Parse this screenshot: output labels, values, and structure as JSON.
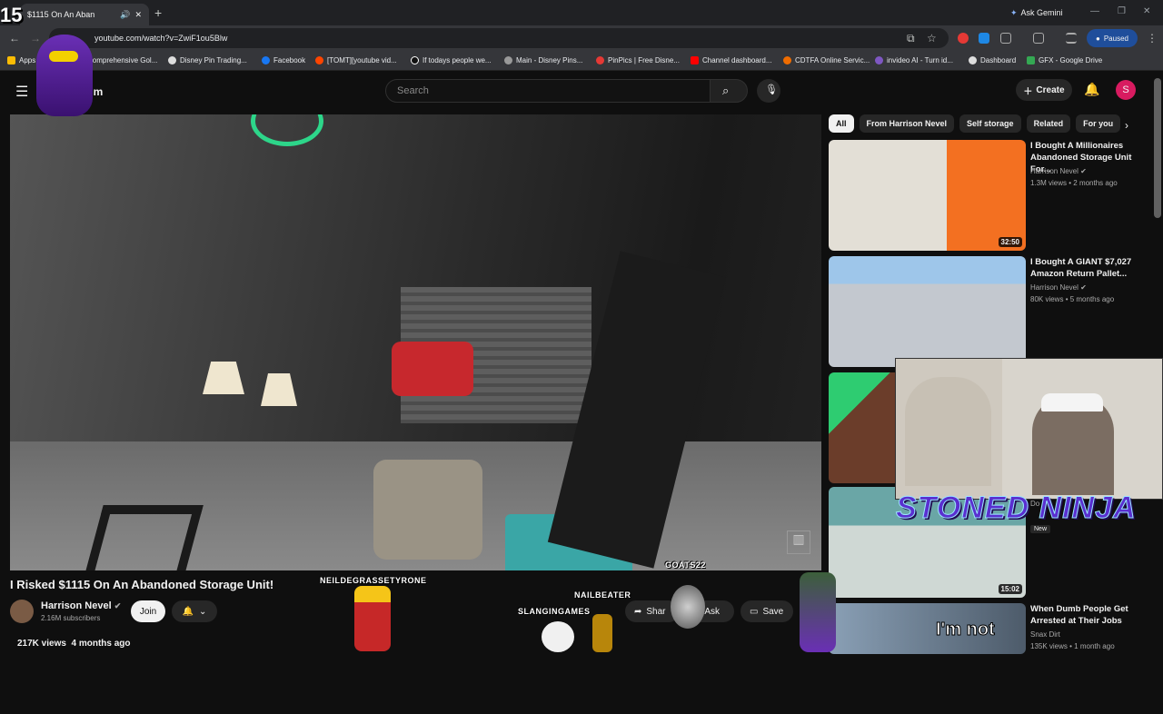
{
  "browser": {
    "tab_title": "$1115 On An Aban",
    "new_tab": "+",
    "ask_gemini": "Ask Gemini",
    "url": "youtube.com/watch?v=ZwiF1ou5Blw",
    "profile_status": "Paused",
    "bookmarks": [
      "Apps",
      "Comprehensive Gol...",
      "Disney Pin Trading...",
      "Facebook",
      "[TOMT][youtube vid...",
      "If todays people we...",
      "Main - Disney Pins...",
      "PinPics | Free Disne...",
      "Channel dashboard...",
      "CDTFA Online Servic...",
      "invideo AI - Turn id...",
      "Dashboard",
      "GFX - Google Drive"
    ]
  },
  "overlay": {
    "counter": "15"
  },
  "youtube": {
    "logo_suffix": "ium",
    "search_placeholder": "Search",
    "create_label": "Create",
    "avatar_letter": "S"
  },
  "video": {
    "title": "I Risked $1115 On An Abandoned Storage Unit!",
    "channel": "Harrison Nevel",
    "subscribers": "2.16M subscribers",
    "join_label": "Join",
    "share_label": "Shar",
    "ask_label": "Ask",
    "save_label": "Save",
    "views": "217K views",
    "age": "4 months ago"
  },
  "chips": [
    "All",
    "From Harrison Nevel",
    "Self storage",
    "Related",
    "For you"
  ],
  "recommendations": [
    {
      "title": "I Bought A Millionaires Abandoned Storage Unit For...",
      "channel": "Harrison Nevel",
      "views": "1.3M views",
      "age": "2 months ago",
      "duration": "32:50",
      "color": "#c9c3b8"
    },
    {
      "title": "I Bought A GIANT $7,027 Amazon Return Pallet...",
      "channel": "Harrison Nevel",
      "views": "80K views",
      "age": "5 months ago",
      "duration": "",
      "color": "#b7c6d8"
    },
    {
      "title": "",
      "channel": "",
      "views": "",
      "age": "",
      "duration": "",
      "color": "#6b3d2a"
    },
    {
      "title": "",
      "channel": "Do",
      "views": "",
      "age": "",
      "duration": "15:02",
      "color": "#9bb0a8"
    },
    {
      "title": "When Dumb People Get Arrested at Their Jobs",
      "channel": "Snax Dirt",
      "views": "135K views",
      "age": "1 month ago",
      "duration": "",
      "color": "#6c7a8a"
    }
  ],
  "stream_overlay": {
    "webcam_text": "STONED NINJA",
    "new_badge": "New",
    "thumb_text": "I'm not",
    "chatters": [
      "NEILDEGRASSETYRONE",
      "NAILBEATER",
      "SLANGINGAMES",
      "GOATS22"
    ]
  }
}
